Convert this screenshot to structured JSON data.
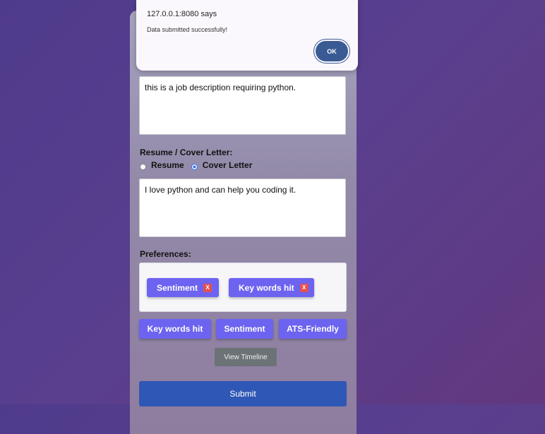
{
  "dialog": {
    "title": "127.0.0.1:8080 says",
    "message": "Data submitted successfully!",
    "ok_label": "OK"
  },
  "form": {
    "job_description_value": "this is a job description requiring python.",
    "resume_label": "Resume / Cover Letter:",
    "radio_resume": "Resume",
    "radio_cover_letter": "Cover Letter",
    "selected_radio": "Cover Letter",
    "resume_value": "I love python and can help you coding it.",
    "preferences_label": "Preferences:",
    "selected_preferences": [
      {
        "label": "Sentiment",
        "remove": "X"
      },
      {
        "label": "Key words hit",
        "remove": "X"
      }
    ],
    "preference_options": [
      "Key words hit",
      "Sentiment",
      "ATS-Friendly"
    ],
    "timeline_label": "View Timeline",
    "submit_label": "Submit"
  }
}
